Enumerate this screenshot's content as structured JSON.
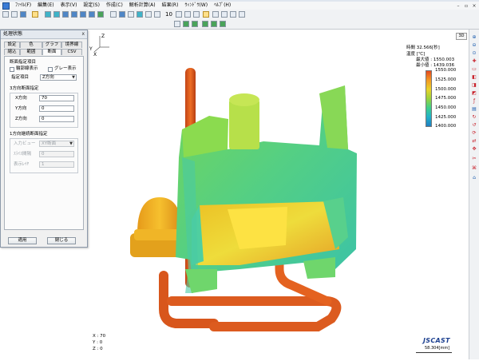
{
  "menubar": {
    "items": [
      "ﾌｧｲﾙ(F)",
      "編集(E)",
      "表示(V)",
      "設定(S)",
      "作成(C)",
      "解析計算(A)",
      "結果(R)",
      "ｳｨﾝﾄﾞｳ(W)",
      "ﾍﾙﾌﾟ(H)"
    ]
  },
  "toolbar": {
    "step_value": "10"
  },
  "dialog": {
    "title": "処理状態",
    "close": "ⅹ",
    "tabs_row1": [
      "設定",
      "色",
      "グラフ",
      "境界線"
    ],
    "tabs_row2": [
      "縮込",
      "範囲",
      "断面",
      "CSV"
    ],
    "section_specify": {
      "title": "断面指定項目",
      "frame_label": "輪郭線表示",
      "gray_label": "グレー表示",
      "item_label": "指定項目",
      "item_value": "Z方向"
    },
    "section_3dir": {
      "title": "3方向断面指定",
      "x_label": "X方向",
      "x_value": "70",
      "y_label": "Y方向",
      "y_value": "0",
      "z_label": "Z方向",
      "z_value": "0"
    },
    "section_1dir": {
      "title": "1方向継続断面指定",
      "view_label": "入力ビュー",
      "view_value": "XY断面",
      "interval_label": "ｽﾗｲｽ間隔",
      "interval_value": "0",
      "layer_label": "表示ﾚｲﾔ",
      "layer_value": "1"
    },
    "apply_label": "適用",
    "close_label": "閉じる"
  },
  "legend": {
    "time_label": "時間 32.566[秒]",
    "quantity_label": "温度 [℃]",
    "max_label": "最大値 : 1550.003",
    "min_label": "最小値 : 1439.036",
    "ticks": [
      "1550.000",
      "1525.000",
      "1500.000",
      "1475.000",
      "1450.000",
      "1425.000",
      "1400.000"
    ],
    "colors": [
      "#e5491e",
      "#f39a23",
      "#e9d32a",
      "#9bd23c",
      "#3fcf8a",
      "#22b1c9",
      "#1f7ec0"
    ]
  },
  "axes": {
    "z": "Z",
    "y": "Y",
    "x": "X"
  },
  "coords": {
    "x": "X :     70",
    "y": "Y :     0",
    "z": "Z :     0"
  },
  "logo": "JSCAST",
  "scale_label": "58.304[mm]",
  "view_button": "3D"
}
